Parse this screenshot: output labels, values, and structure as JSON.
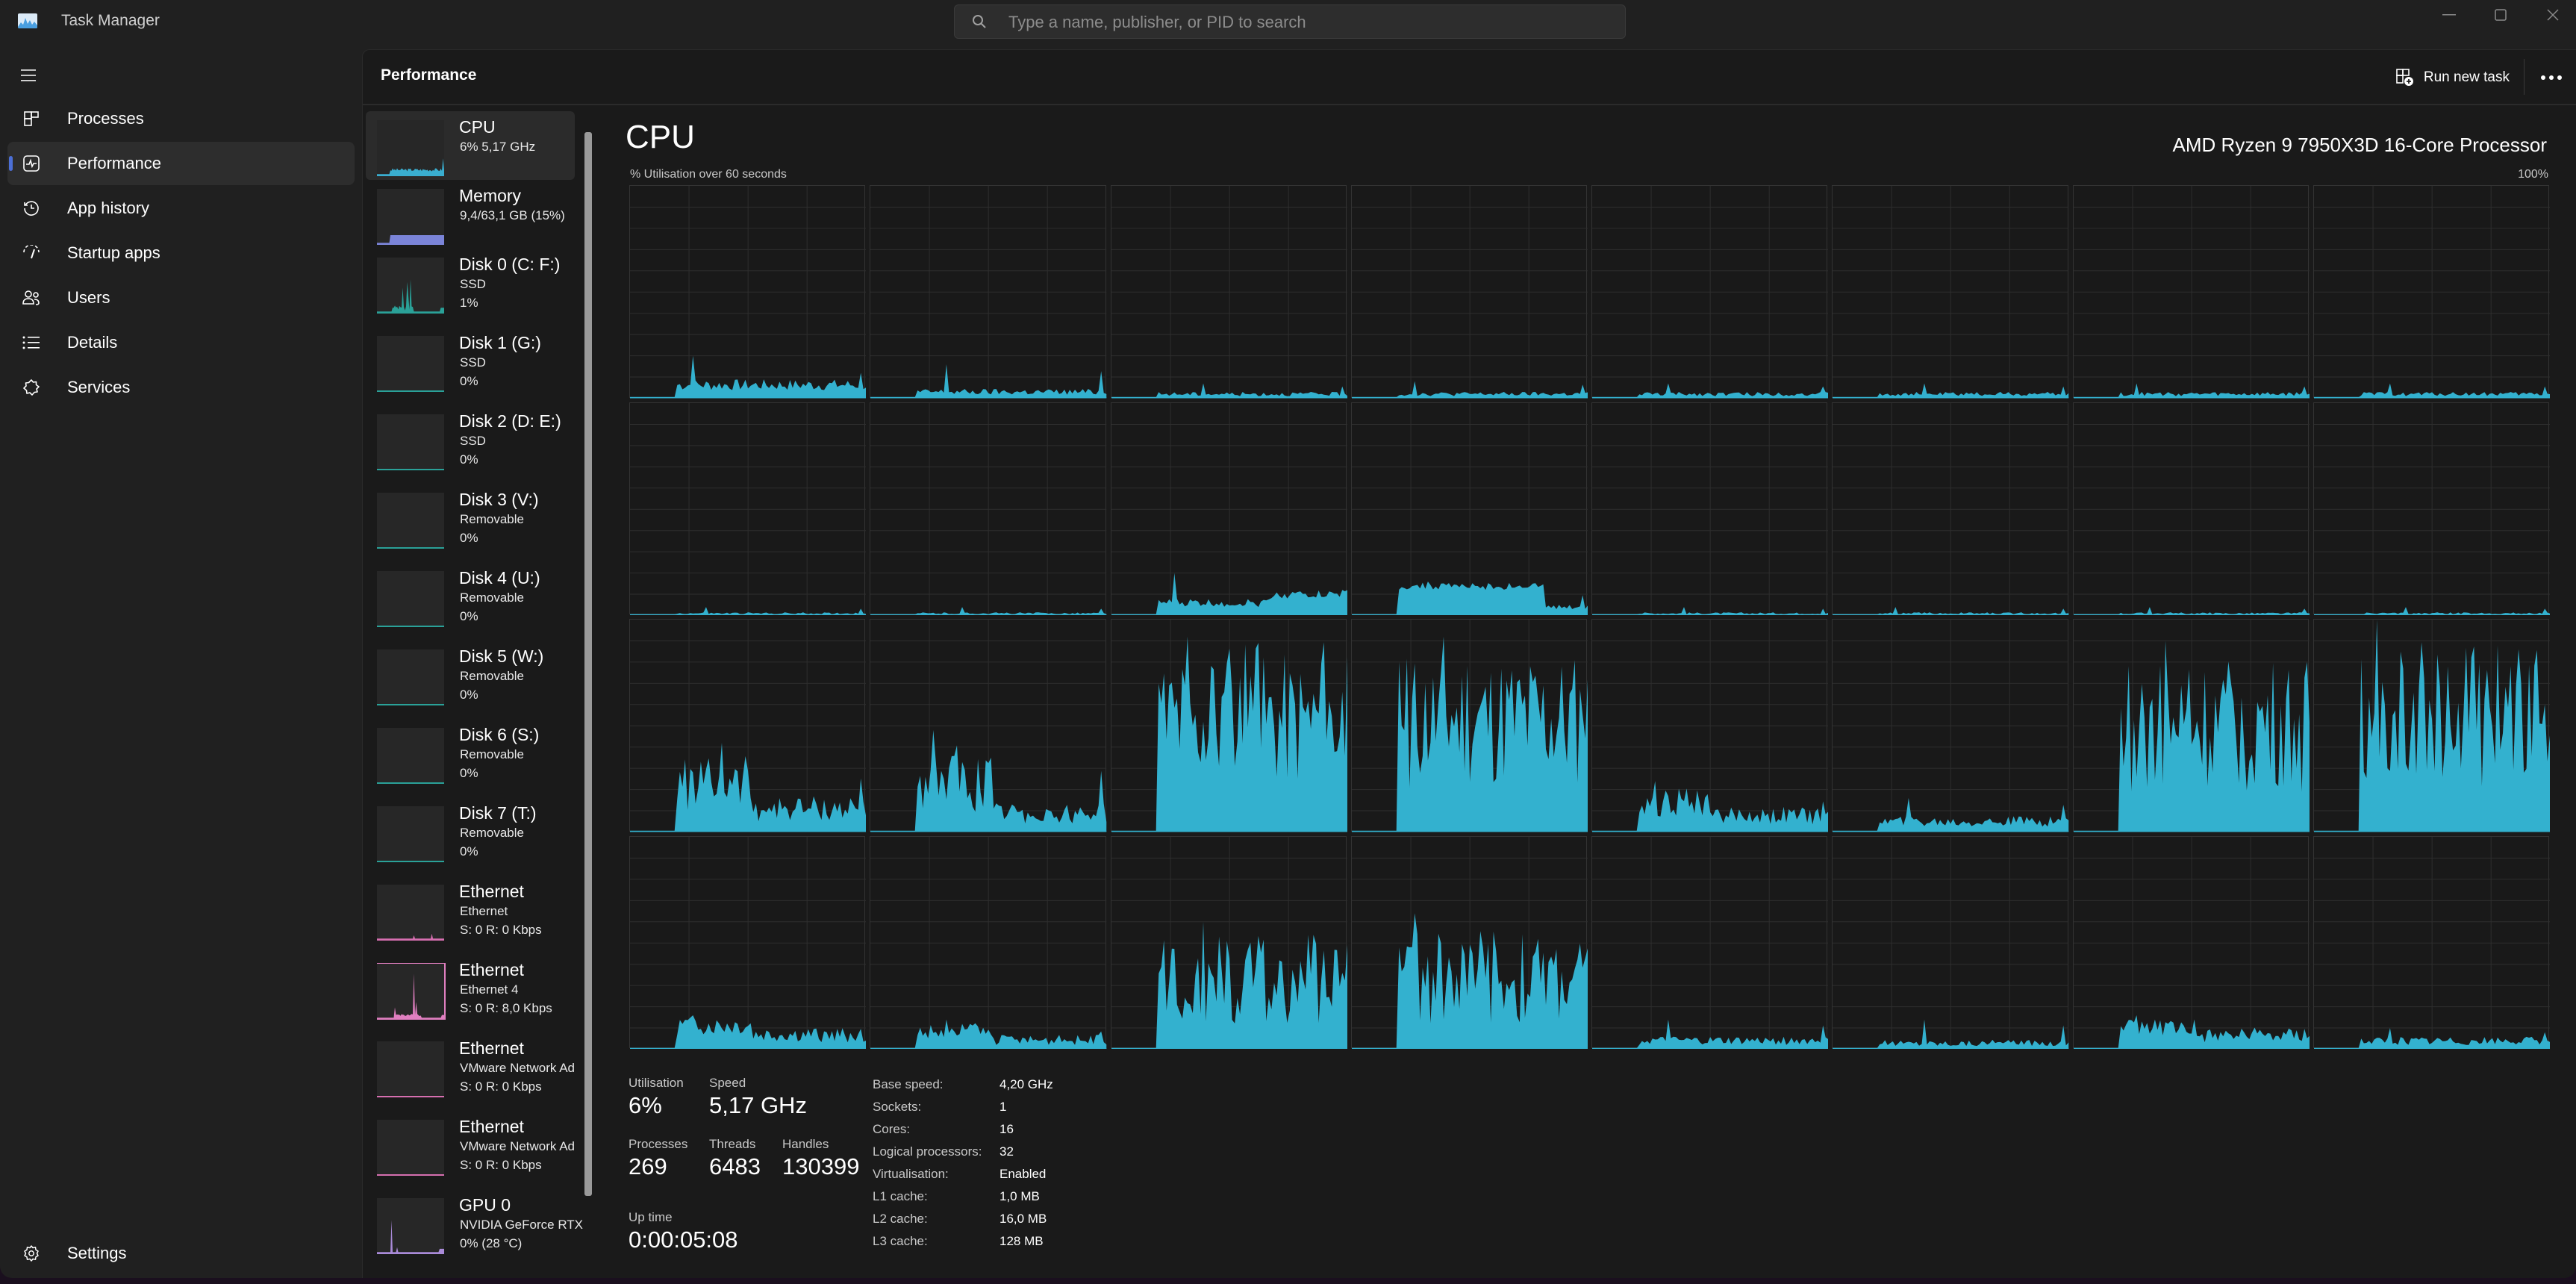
{
  "window": {
    "title": "Task Manager",
    "search_placeholder": "Type a name, publisher, or PID to search",
    "controls": [
      "minimize",
      "maximize",
      "close"
    ]
  },
  "nav": {
    "items": [
      {
        "label": "Processes",
        "icon": "processes-icon"
      },
      {
        "label": "Performance",
        "icon": "performance-icon",
        "active": true
      },
      {
        "label": "App history",
        "icon": "app-history-icon"
      },
      {
        "label": "Startup apps",
        "icon": "startup-apps-icon"
      },
      {
        "label": "Users",
        "icon": "users-icon"
      },
      {
        "label": "Details",
        "icon": "details-icon"
      },
      {
        "label": "Services",
        "icon": "services-icon"
      }
    ],
    "settings_label": "Settings"
  },
  "header": {
    "title": "Performance",
    "run_new_task": "Run new task"
  },
  "devices": [
    {
      "name": "CPU",
      "sub": "6%  5,17 GHz",
      "sub2": "",
      "color": "#3aaed0",
      "active": true,
      "kind": "cpu"
    },
    {
      "name": "Memory",
      "sub": "9,4/63,1 GB (15%)",
      "sub2": "",
      "color": "#7b84d8",
      "kind": "mem"
    },
    {
      "name": "Disk 0 (C: F:)",
      "sub": "SSD",
      "sub2": "1%",
      "color": "#2aa198",
      "kind": "disk0"
    },
    {
      "name": "Disk 1 (G:)",
      "sub": "SSD",
      "sub2": "0%",
      "color": "#2aa198",
      "kind": "flat"
    },
    {
      "name": "Disk 2 (D: E:)",
      "sub": "SSD",
      "sub2": "0%",
      "color": "#2aa198",
      "kind": "flat"
    },
    {
      "name": "Disk 3 (V:)",
      "sub": "Removable",
      "sub2": "0%",
      "color": "#2aa198",
      "kind": "flat"
    },
    {
      "name": "Disk 4 (U:)",
      "sub": "Removable",
      "sub2": "0%",
      "color": "#2aa198",
      "kind": "flat"
    },
    {
      "name": "Disk 5 (W:)",
      "sub": "Removable",
      "sub2": "0%",
      "color": "#2aa198",
      "kind": "flat"
    },
    {
      "name": "Disk 6 (S:)",
      "sub": "Removable",
      "sub2": "0%",
      "color": "#2aa198",
      "kind": "flat"
    },
    {
      "name": "Disk 7 (T:)",
      "sub": "Removable",
      "sub2": "0%",
      "color": "#2aa198",
      "kind": "flat"
    },
    {
      "name": "Ethernet",
      "sub": "Ethernet",
      "sub2": "S: 0  R: 0 Kbps",
      "color": "#d66fb0",
      "kind": "eth0"
    },
    {
      "name": "Ethernet",
      "sub": "Ethernet 4",
      "sub2": "S: 0  R: 8,0 Kbps",
      "color": "#e07fc0",
      "kind": "eth4"
    },
    {
      "name": "Ethernet",
      "sub": "VMware Network Ad",
      "sub2": "S: 0  R: 0 Kbps",
      "color": "#d66fb0",
      "kind": "flatpink"
    },
    {
      "name": "Ethernet",
      "sub": "VMware Network Ad",
      "sub2": "S: 0  R: 0 Kbps",
      "color": "#d66fb0",
      "kind": "flatpink"
    },
    {
      "name": "GPU 0",
      "sub": "NVIDIA GeForce RTX",
      "sub2": "0%  (28 °C)",
      "color": "#a98ad8",
      "kind": "gpu"
    }
  ],
  "cpu": {
    "title": "CPU",
    "model": "AMD Ryzen 9 7950X3D 16-Core Processor",
    "graph_caption": "% Utilisation over 60 seconds",
    "graph_max": "100%",
    "accent": "#33b1cf",
    "stats": {
      "utilisation_label": "Utilisation",
      "utilisation": "6%",
      "speed_label": "Speed",
      "speed": "5,17 GHz",
      "processes_label": "Processes",
      "processes": "269",
      "threads_label": "Threads",
      "threads": "6483",
      "handles_label": "Handles",
      "handles": "130399",
      "uptime_label": "Up time",
      "uptime": "0:00:05:08"
    },
    "specs": [
      {
        "label": "Base speed:",
        "value": "4,20 GHz"
      },
      {
        "label": "Sockets:",
        "value": "1"
      },
      {
        "label": "Cores:",
        "value": "16"
      },
      {
        "label": "Logical processors:",
        "value": "32"
      },
      {
        "label": "Virtualisation:",
        "value": "Enabled"
      },
      {
        "label": "L1 cache:",
        "value": "1,0 MB"
      },
      {
        "label": "L2 cache:",
        "value": "16,0 MB"
      },
      {
        "label": "L3 cache:",
        "value": "128 MB"
      }
    ]
  },
  "chart_data": {
    "type": "area",
    "title": "CPU",
    "xlabel": "60 seconds",
    "ylabel": "% Utilisation",
    "ylim": [
      0,
      100
    ],
    "grid": true,
    "layout": "8 columns x 4 rows of logical processors",
    "series_peaks_percent": [
      [
        20,
        16,
        7,
        8,
        7,
        7,
        7,
        7
      ],
      [
        4,
        4,
        20,
        16,
        4,
        4,
        4,
        4
      ],
      [
        42,
        48,
        92,
        92,
        24,
        16,
        90,
        100
      ],
      [
        16,
        14,
        60,
        64,
        14,
        14,
        16,
        10
      ]
    ],
    "series_typical_percent": [
      [
        6,
        3,
        2,
        2,
        2,
        2,
        2,
        2
      ],
      [
        1,
        1,
        8,
        12,
        1,
        1,
        1,
        1
      ],
      [
        10,
        8,
        25,
        20,
        7,
        5,
        18,
        20
      ],
      [
        6,
        4,
        12,
        12,
        4,
        3,
        6,
        4
      ]
    ],
    "series_shape": [
      [
        "spiky",
        "low",
        "low",
        "low",
        "low",
        "low",
        "low",
        "low"
      ],
      [
        "low",
        "low",
        "rising",
        "plateau",
        "low",
        "low",
        "low",
        "low"
      ],
      [
        "burst",
        "burst",
        "heavy",
        "heavy",
        "burst",
        "low",
        "heavy",
        "heavy"
      ],
      [
        "burst",
        "burst",
        "heavy",
        "heavy",
        "low",
        "low",
        "burst",
        "low"
      ]
    ],
    "idle_fraction_at_start": 0.19
  }
}
